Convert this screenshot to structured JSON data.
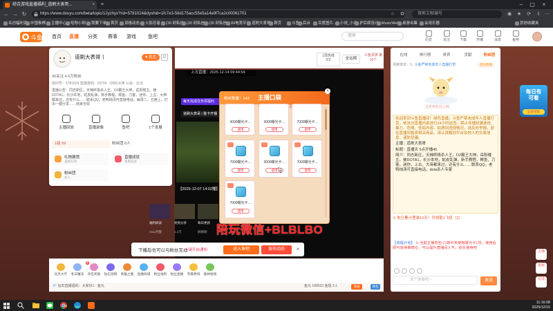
{
  "browser": {
    "tab_title": "综合游戏直播福利_道刷大表哥...",
    "url": "https://www.douyu.com/beta/topic/12yzhyx?rid=5781024&dyshid=1fc7e3-58d175acc55e5a14e9f7ca2c00061701",
    "search_placeholder": "搜索文献编号",
    "bookmarks": [
      "名创福利资…",
      "中国象棋…",
      "主播中心",
      "哈勃小网…",
      "我要下单",
      "首页",
      "资格动态…",
      "火影忍者…",
      "(30 封私信)…",
      "(30 封私信)…",
      "(30 封私信)…",
      "09电竞平台",
      "道刷大表哥…",
      "首页",
      "斗鱼…",
      "后台",
      "百度图片…",
      "小说_小说…",
      "护后续设计…",
      "MusicWeb…",
      "桌游合集",
      "会用乐器",
      "其他收藏夹"
    ]
  },
  "site": {
    "logo_text": "斗鱼",
    "nav": [
      "首页",
      "直播",
      "分类",
      "赛事",
      "游戏",
      "鱼吧"
    ],
    "nav_active": 1,
    "search_placeholder": "搜索",
    "header_icons": [
      "历史",
      "关注",
      "下载",
      "开播",
      "消息",
      "鱼吧"
    ]
  },
  "streamer": {
    "name": "道刷大表哥丨",
    "follow_label": "关注",
    "fans": "45关注    4.6万粉丝",
    "meta": "房间号：5781024    直播游戏：DOTA · OMG大神    公会：云汉",
    "intro": "直播公告：同志新区，天梯终极杀人王，D2霸王大神，岳阳楼主。被DOTA1，长沙本地，蛇皮乱弹，新手教程，鳄鱼，刀客，迷你，上古，大帝都来过，还有什么……联系QQ，老鸭炖汤可直接电话，每周二，五晚上，打出一键分享……结束无效",
    "actions": [
      "主播回放",
      "直播录像",
      "鱼吧",
      "1个发展"
    ],
    "level": "1级 59",
    "hearts": "粉丝团  0人",
    "tiles": [
      {
        "title": "礼物展馆",
        "sub": "查看礼物",
        "color": "#f7a23b"
      },
      {
        "title": "直播成就",
        "sub": "查看成就",
        "color": "#f05a6a"
      },
      {
        "title": "粉丝团",
        "sub": "加入",
        "color": "#f2b33b"
      }
    ]
  },
  "video": {
    "uptime": "上次直播：2025-12-14 09:44:54",
    "banner": "每天完成任务领福利",
    "banner2": "道刷大表哥 | 整卡开播",
    "caption": "【2025-12-07 14:02播】",
    "thumbs": [
      {
        "label": "福利阅读",
        "sub": "Xiao月醒",
        "color": "#3b2a4a"
      },
      {
        "label": "亮亮分享",
        "sub": "1.2万",
        "color": "#4a4130"
      },
      {
        "label": "每日更新",
        "sub": "刷刷刷",
        "color": "#3a3a2b"
      }
    ],
    "rank_box": "1周热榜",
    "rank_value": "0/3",
    "all_site": "全站榜",
    "nobles": "斗鱼贵族 第10个"
  },
  "pocket": {
    "fans_count": "粉丝数量：143",
    "title": "主播口袋",
    "tabs": [
      "主播道具",
      "权益装备",
      "宝贝"
    ],
    "tab_active": 0,
    "extra_tab": "福利券",
    "items": [
      {
        "label": "3000曝光卡…",
        "use": "使用",
        "has_icon": false
      },
      {
        "label": "3000曝光卡…",
        "use": "使用",
        "has_icon": false
      },
      {
        "label": "7000曝光卡…",
        "use": "使用",
        "has_icon": false
      },
      {
        "label": "7000曝光卡…",
        "use": "使用",
        "has_icon": true
      },
      {
        "label": "3000曝光卡…",
        "use": "使用",
        "has_icon": true
      },
      {
        "label": "7000曝光卡…",
        "use": "使用",
        "has_icon": true
      },
      {
        "label": "7000曝光卡…",
        "use": "使用",
        "has_icon": true
      }
    ]
  },
  "watermark": "陪玩微信+BLBLBO",
  "prompt": {
    "text": "下播后也可以与粉丝互动",
    "link": "一键开启通知",
    "join": "进入鱼吧",
    "send": "发布动态"
  },
  "giftbar": {
    "gifts": [
      {
        "name": "任务大厅",
        "color": "#f1b63b"
      },
      {
        "name": "冬日魔法",
        "color": "#8fb4f5",
        "tag": "新"
      },
      {
        "name": "背包奖励",
        "color": "#e58ac0"
      },
      {
        "name": "钻石宠物",
        "color": "#7a6af0"
      },
      {
        "name": "英雄之路",
        "color": "#f08a3b"
      },
      {
        "name": "直播商城",
        "color": "#5ab0f5"
      },
      {
        "name": "粉丝福利",
        "color": "#f05a6a"
      },
      {
        "name": "粉丝直播",
        "color": "#9a7af5"
      },
      {
        "name": "专属秀场",
        "color": "#f5c03b"
      },
      {
        "name": "森林秘境",
        "color": "#7ac55a"
      }
    ],
    "bottom_text": "💎 钻石直播福利：大家好1 · 鱼丸",
    "right_text": "鱼丸 188533   鱼翅 3.1",
    "recharge": "充值",
    "pack": "背包"
  },
  "chat": {
    "tabs": [
      "在线",
      "排行榜",
      "贵宾",
      "贡献",
      "粉丝团"
    ],
    "tab_active": 4,
    "rank_header": "贡献榜单：S·",
    "rank_header_hl": "斗鱼严禁未成年人直播打赏",
    "rank_button": "成为贵族",
    "empty_text": "还未有粉丝上榜",
    "notice_lines": [
      "欢迎来到斗鱼直播间！绿色直播，斗鱼严禁未成年人直播打赏，依法对直播内容进行24小时巡查。禁止传播封建迷信、暴力、色情、低俗内容。如遇到违规情况，请及时举报。若在直播间售卖相关商品，请认真甄别平台及他人的交易信息，谨防受骗。",
      "主播：道刷大表哥",
      "标题：直播天 5点开播40",
      "简介：同志新区，天梯终极杀人王，D2霸王大神，岳阳楼主。被DOTA1，长沙本地，蛇皮乱弹，新手教程，鳄鱼，刀客，迷你，上古，大帝都来过，还有什么……联系QQ，老鸭炖汤可直接电话，dota杀人专家"
    ],
    "lotto": "⊙ 你已累计登录15天！可领取1飞机（2）",
    "newinfo_label": "【流程计划】",
    "newinfo": "⊙ 当前主播背包-口袋中未使用曝光卡1张，使用后即可获得推荐位，可以提升直播间人气，抢先使用吧",
    "input_placeholder": "发个弹幕吧~",
    "send": "发送"
  },
  "float": {
    "banner_title": "每日有",
    "banner_title2": "可看",
    "banner_btn": "立即领取",
    "side": [
      "主播",
      "客服",
      "反馈"
    ]
  },
  "taskbar": {
    "time": "11:16:08",
    "date": "2025/12/15"
  }
}
